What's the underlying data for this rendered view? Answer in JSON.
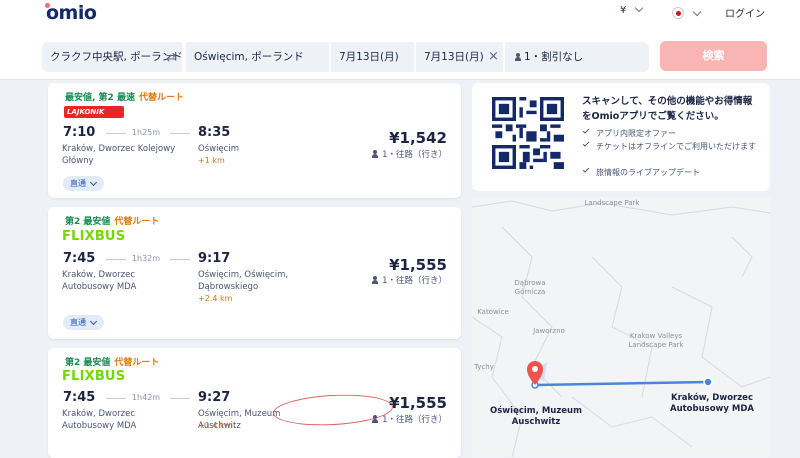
{
  "header": {
    "logo": "omio",
    "currency": "¥",
    "login": "ログイン"
  },
  "search": {
    "from": "クラクフ中央駅, ポーランド",
    "to": "Oświęcim, ポーランド",
    "depart": "7月13日(月)",
    "return": "7月13日(月)",
    "passengers": "1・割引なし",
    "button": "検索"
  },
  "results": [
    {
      "tags": [
        "最安値, 第2 最速"
      ],
      "tag_alt": "代替ルート",
      "carrier": "LAJKONIK BUS.PL",
      "dep_time": "7:10",
      "duration": "1h25m",
      "arr_time": "8:35",
      "from_station": "Kraków, Dworzec Kolejowy Główny",
      "to_station": "Oświęcim",
      "walk": "+1 km",
      "price": "¥1,542",
      "trip": "1・往路（行き）",
      "direct": "直通"
    },
    {
      "tags": [
        "第2 最安値"
      ],
      "tag_alt": "代替ルート",
      "carrier": "FLIXBUS",
      "dep_time": "7:45",
      "duration": "1h32m",
      "arr_time": "9:17",
      "from_station": "Kraków, Dworzec Autobusowy MDA",
      "to_station": "Oświęcim, Oświęcim, Dąbrowskiego",
      "walk": "+2.4 km",
      "price": "¥1,555",
      "trip": "1・往路（行き）",
      "direct": "直通"
    },
    {
      "tags": [
        "第2 最安値"
      ],
      "tag_alt": "代替ルート",
      "carrier": "FLIXBUS",
      "dep_time": "7:45",
      "duration": "1h42m",
      "arr_time": "9:27",
      "from_station": "Kraków, Dworzec Autobusowy MDA",
      "to_station": "Oświęcim, Muzeum Auschwitz",
      "walk": "+1.4 km",
      "price": "¥1,555",
      "trip": "1・往路（行き）"
    }
  ],
  "promo": {
    "title": "スキャンして、その他の機能やお得情報をOmioアプリでご覧ください。",
    "bullets": [
      "アプリ内限定オファー",
      "チケットはオフラインでご利用いただけます",
      "旅情報のライブアップデート"
    ]
  },
  "map": {
    "labels": [
      "Landscape Park",
      "Dąbrowa Górnicza",
      "Katowice",
      "Jaworzno",
      "Tychy",
      "Krakow Valleys Landscape Park"
    ],
    "origin": "Kraków, Dworzec Autobusowy MDA",
    "destination": "Oświęcim, Muzeum Auschwitz",
    "pin_color": "#f0524f",
    "route_color": "#4a86d8"
  }
}
